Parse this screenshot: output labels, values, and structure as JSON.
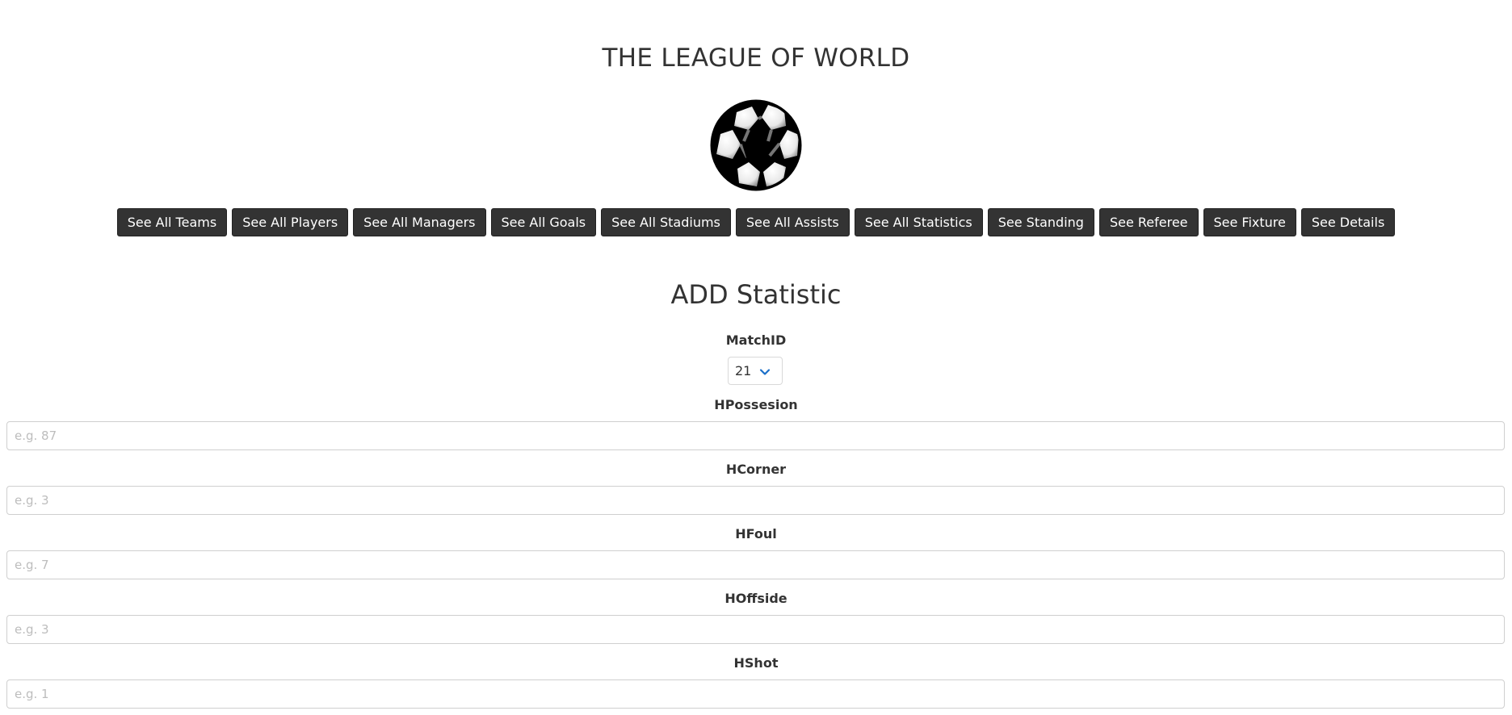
{
  "header": {
    "title": "THE LEAGUE OF WORLD",
    "logo_icon": "soccer-ball-icon"
  },
  "nav": {
    "buttons": [
      {
        "label": "See All Teams"
      },
      {
        "label": "See All Players"
      },
      {
        "label": "See All Managers"
      },
      {
        "label": "See All Goals"
      },
      {
        "label": "See All Stadiums"
      },
      {
        "label": "See All Assists"
      },
      {
        "label": "See All Statistics"
      },
      {
        "label": "See Standing"
      },
      {
        "label": "See Referee"
      },
      {
        "label": "See Fixture"
      },
      {
        "label": "See Details"
      }
    ],
    "button_color": "#333333",
    "button_text_color": "#ffffff"
  },
  "form": {
    "title": "ADD Statistic",
    "match": {
      "label": "MatchID",
      "selected": "21",
      "chevron_icon": "chevron-down-icon",
      "chevron_color": "#1a6fc9"
    },
    "fields": [
      {
        "label": "HPossesion",
        "placeholder": "e.g. 87",
        "value": ""
      },
      {
        "label": "HCorner",
        "placeholder": "e.g. 3",
        "value": ""
      },
      {
        "label": "HFoul",
        "placeholder": "e.g. 7",
        "value": ""
      },
      {
        "label": "HOffside",
        "placeholder": "e.g. 3",
        "value": ""
      },
      {
        "label": "HShot",
        "placeholder": "e.g. 1",
        "value": ""
      }
    ]
  }
}
